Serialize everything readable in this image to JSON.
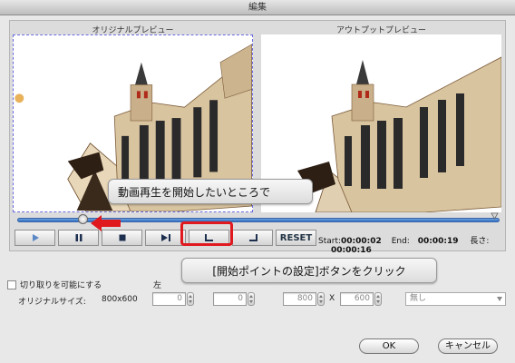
{
  "window": {
    "title": "編集"
  },
  "preview": {
    "original_label": "オリジナルプレビュー",
    "output_label": "アウトプットプレビュー"
  },
  "controls": {
    "reset_label": "RESET",
    "start_label": "Start:",
    "start_value": "00:00:02",
    "end_label": "End:",
    "end_value": "00:00:19",
    "length_label": "長さ:",
    "length_value": "00:00:16"
  },
  "annotations": {
    "callout_seek": "動画再生を開始したいところで",
    "callout_button": "[開始ポイントの設定]ボタンをクリック"
  },
  "crop": {
    "enable_label": "切り取りを可能にする",
    "left_label": "左",
    "original_size_label": "オリジナルサイズ:",
    "original_size_value": "800x600",
    "left_value": "0",
    "top_value": "0",
    "width_value": "800",
    "height_value": "600",
    "x_sep": "X",
    "aspect_value": "無し"
  },
  "footer": {
    "ok_label": "OK",
    "cancel_label": "キャンセル"
  }
}
